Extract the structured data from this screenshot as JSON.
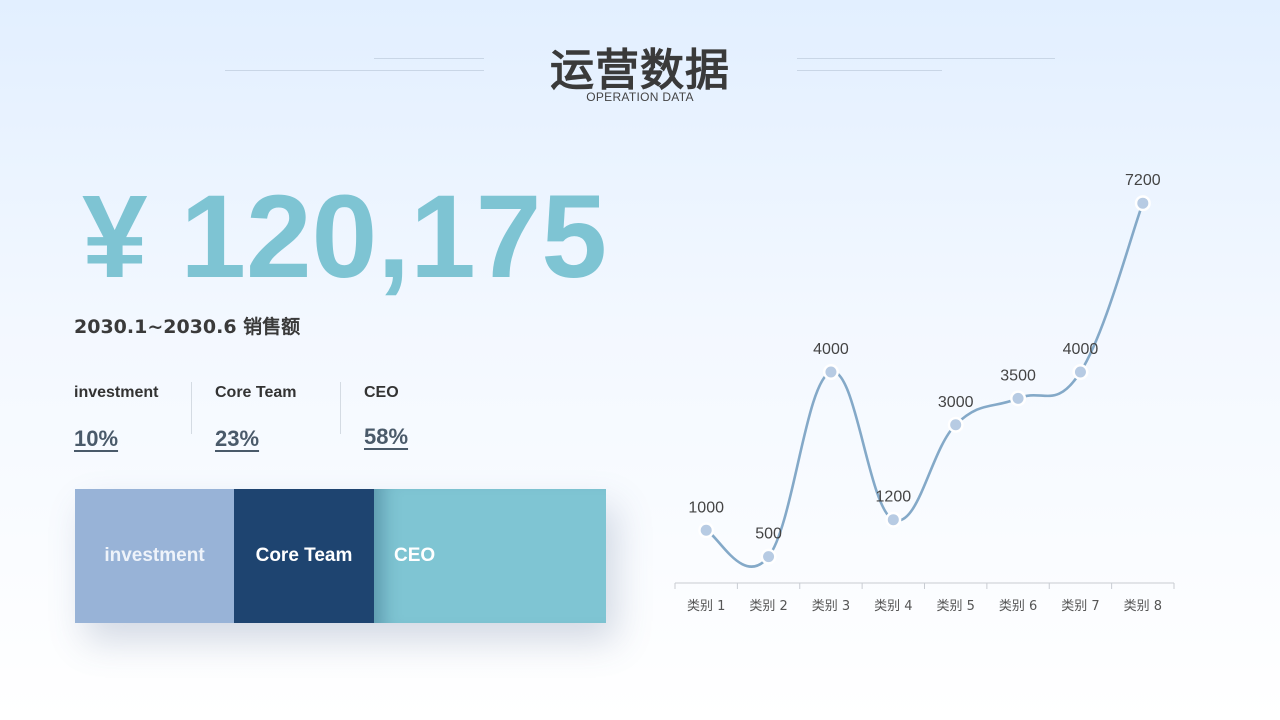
{
  "header": {
    "title": "运营数据",
    "subtitle": "OPERATION DATA"
  },
  "summary": {
    "amount": "¥ 120,175",
    "period": "2030.1~2030.6 销售额"
  },
  "stats": [
    {
      "label": "investment",
      "value": "10%"
    },
    {
      "label": "Core Team",
      "value": "23%"
    },
    {
      "label": "CEO",
      "value": "58%"
    }
  ],
  "share_bar": {
    "segments": [
      {
        "label": "investment",
        "color": "#98b3d7"
      },
      {
        "label": "Core Team",
        "color": "#1e4470"
      },
      {
        "label": "CEO",
        "color": "#7fc5d3"
      }
    ]
  },
  "colors": {
    "accent": "#7ec4d3",
    "line": "#84a9c8",
    "marker": "#b7cbe3"
  },
  "chart_data": {
    "type": "line",
    "categories": [
      "类别 1",
      "类别 2",
      "类别 3",
      "类别 4",
      "类别 5",
      "类别 6",
      "类别 7",
      "类别 8"
    ],
    "values": [
      1000,
      500,
      4000,
      1200,
      3000,
      3500,
      4000,
      7200
    ],
    "data_labels": [
      "1000",
      "500",
      "4000",
      "1200",
      "3000",
      "3500",
      "4000",
      "7200"
    ],
    "title": "",
    "xlabel": "",
    "ylabel": "",
    "ylim": [
      0,
      8000
    ],
    "smooth": true,
    "grid": false,
    "legend": "none"
  }
}
